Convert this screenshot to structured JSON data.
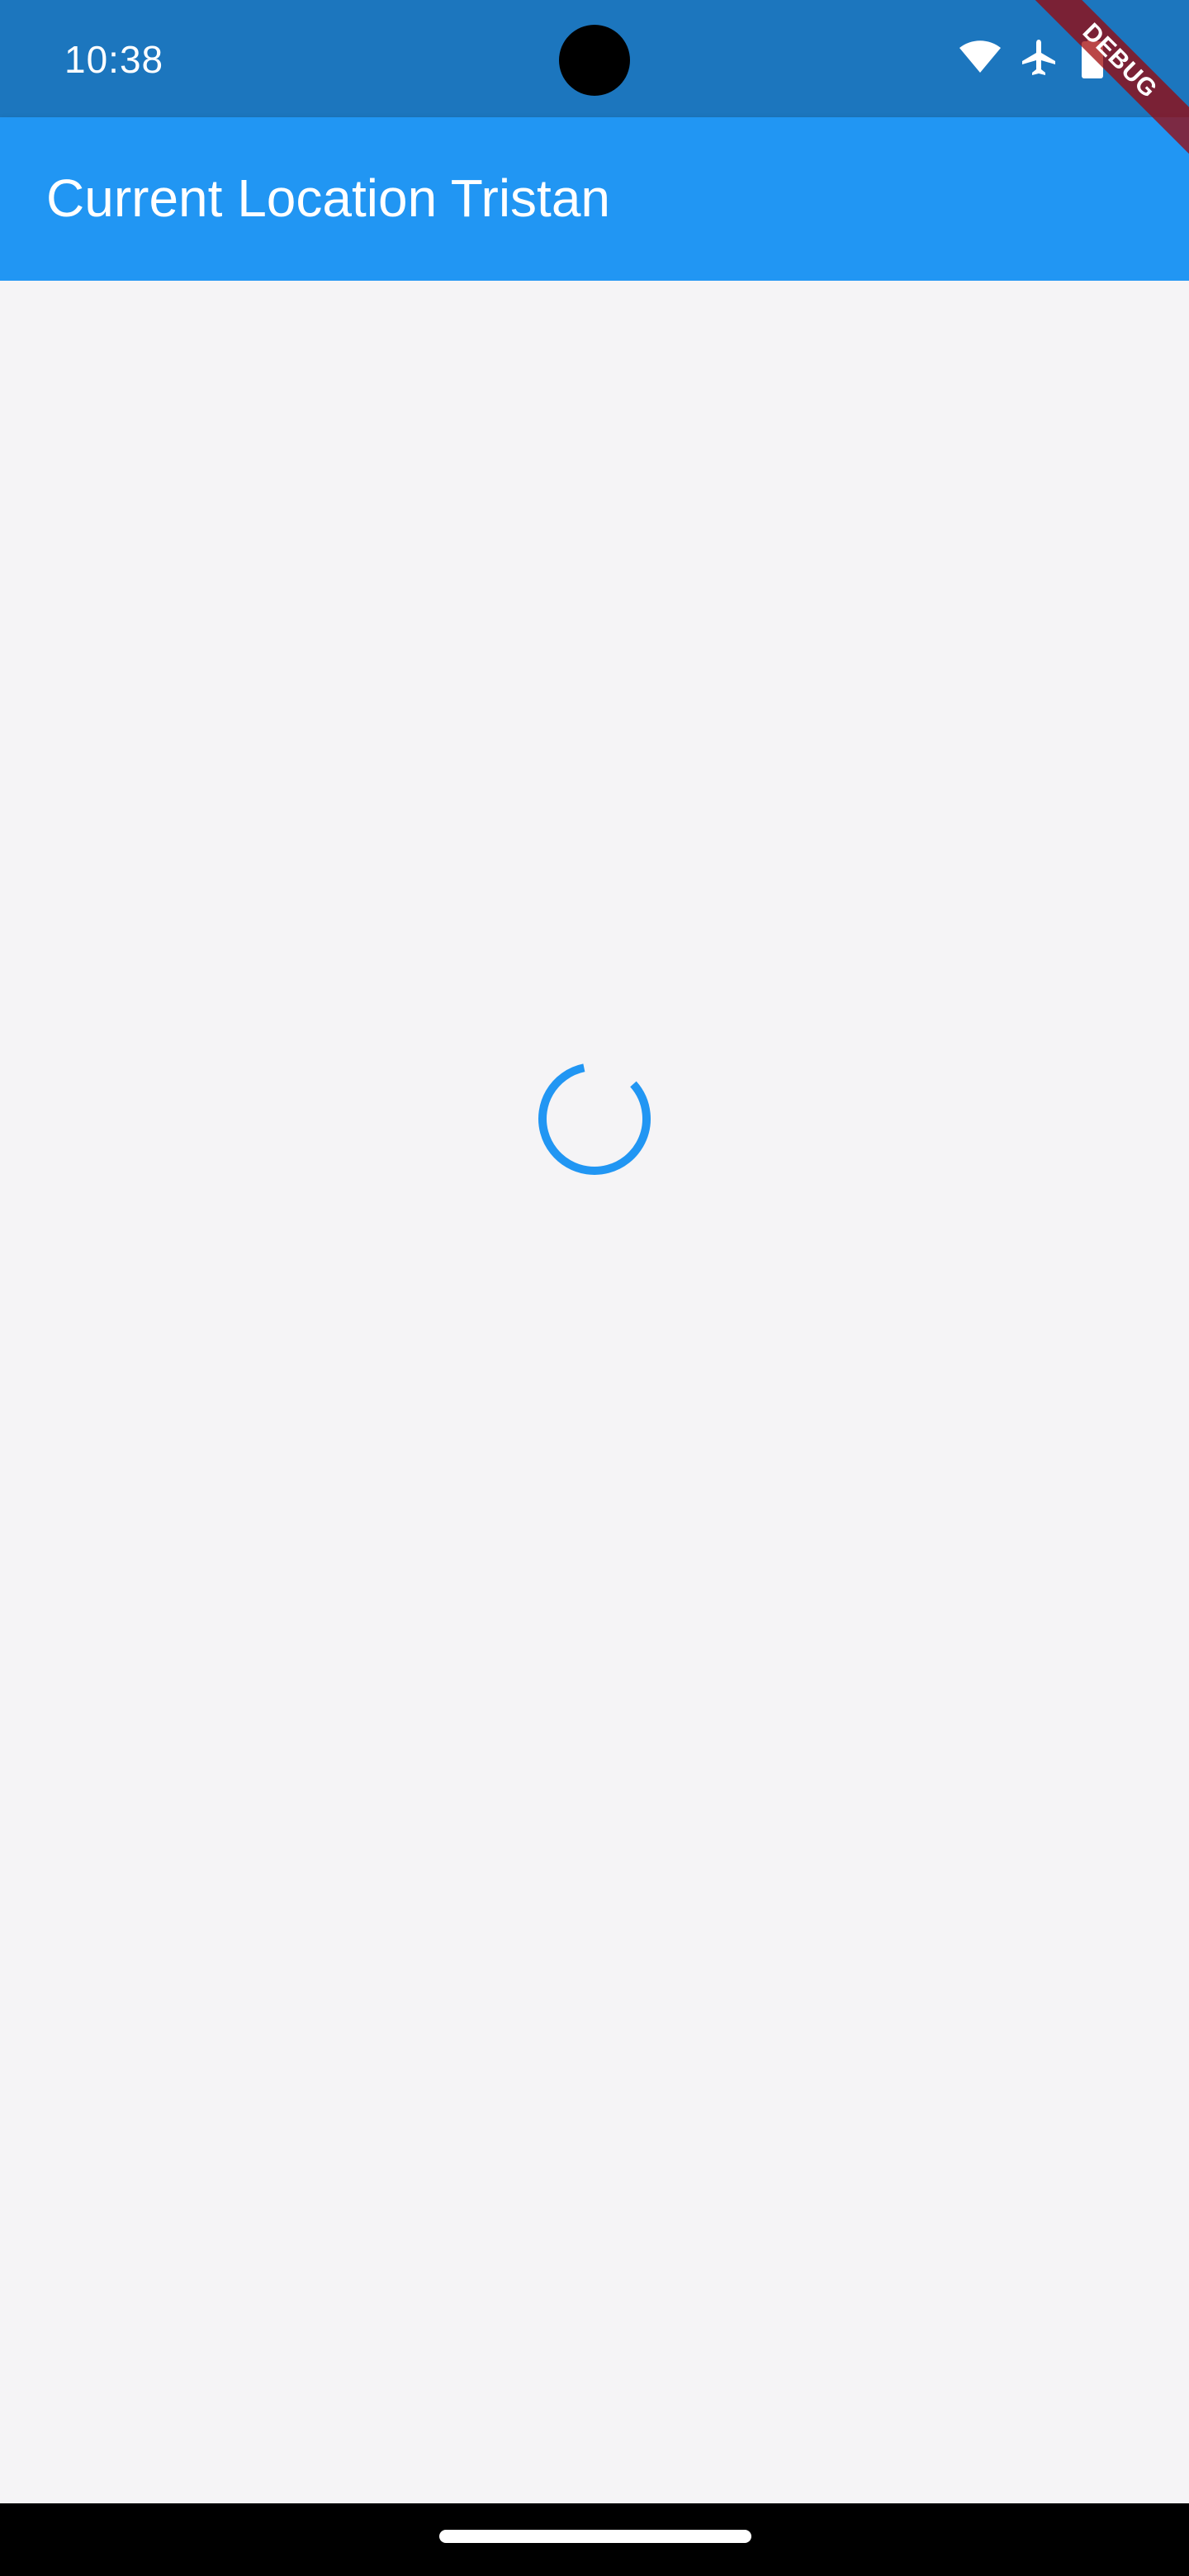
{
  "status_bar": {
    "time": "10:38",
    "icons": [
      "wifi-icon",
      "airplane-mode-icon",
      "battery-icon"
    ],
    "color": "#1c76be"
  },
  "app_bar": {
    "title": "Current Location Tristan",
    "color": "#2196f3"
  },
  "debug_banner": {
    "label": "DEBUG"
  },
  "content": {
    "loading_indicator": "progress-spinner",
    "spinner_color": "#2196f3"
  },
  "navigation_bar": {
    "gesture": "home-indicator"
  }
}
